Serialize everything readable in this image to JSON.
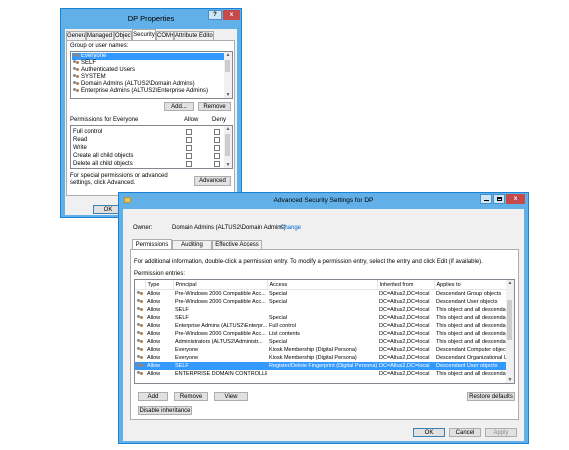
{
  "dp": {
    "title": "DP Properties",
    "help_btn": "?",
    "close_btn": "x",
    "tabs": [
      "General",
      "Managed By",
      "Object",
      "Security",
      "COM+",
      "Attribute Editor"
    ],
    "active_tab": "Security",
    "group_label": "Group or user names:",
    "users": [
      "Everyone",
      "SELF",
      "Authenticated Users",
      "SYSTEM",
      "Domain Admins (ALTUS2\\Domain Admins)",
      "Enterprise Admins (ALTUS2\\Enterprise Admins)"
    ],
    "add_btn": "Add...",
    "remove_btn": "Remove",
    "perm_label": "Permissions for Everyone",
    "allow": "Allow",
    "deny": "Deny",
    "permissions": [
      "Full control",
      "Read",
      "Write",
      "Create all child objects",
      "Delete all child objects"
    ],
    "special_text": "For special permissions or advanced settings, click Advanced.",
    "advanced_btn": "Advanced",
    "ok_btn": "OK"
  },
  "adv": {
    "title": "Advanced Security Settings for DP",
    "owner_label": "Owner:",
    "owner_value": "Domain Admins (ALTUS2\\Domain Admins)",
    "change_link": "Change",
    "tabs": [
      "Permissions",
      "Auditing",
      "Effective Access"
    ],
    "active_tab": "Permissions",
    "info_text": "For additional information, double-click a permission entry. To modify a permission entry, select the entry and click Edit (if available).",
    "entries_label": "Permission entries:",
    "columns": [
      "Type",
      "Principal",
      "Access",
      "Inherited from",
      "Applies to"
    ],
    "rows": [
      [
        "Allow",
        "Pre-Windows 2000 Compatible Acc...",
        "Special",
        "DC=Altus2,DC=local",
        "Descendant Group objects"
      ],
      [
        "Allow",
        "Pre-Windows 2000 Compatible Acc...",
        "Special",
        "DC=Altus2,DC=local",
        "Descendant User objects"
      ],
      [
        "Allow",
        "SELF",
        "",
        "DC=Altus2,DC=local",
        "This object and all descendant"
      ],
      [
        "Allow",
        "SELF",
        "Special",
        "DC=Altus2,DC=local",
        "This object and all descendant"
      ],
      [
        "Allow",
        "Enterprise Admins (ALTUS2\\Enterpr...",
        "Full control",
        "DC=Altus2,DC=local",
        "This object and all descendant"
      ],
      [
        "Allow",
        "Pre-Windows 2000 Compatible Acc...",
        "List contents",
        "DC=Altus2,DC=local",
        "This object and all descendant"
      ],
      [
        "Allow",
        "Administrators (ALTUS2\\Administr...",
        "Special",
        "DC=Altus2,DC=local",
        "This object and all descendant"
      ],
      [
        "Allow",
        "Everyone",
        "Kiosk Membership (Digital Persona)",
        "DC=Altus2,DC=local",
        "Descendant Computer objects"
      ],
      [
        "Allow",
        "Everyone",
        "Kiosk Membership (Digital Persona)",
        "DC=Altus2,DC=local",
        "Descendant Organizational Uni"
      ],
      [
        "Allow",
        "SELF",
        "Register/Delete Fingerprint (Digital Persona)",
        "DC=Altus2,DC=local",
        "Descendant User objects"
      ],
      [
        "Allow",
        "ENTERPRISE DOMAIN CONTROLLE...",
        "",
        "DC=Altus2,DC=local",
        "This object and all descendant"
      ]
    ],
    "selected_row": 9,
    "add_btn": "Add",
    "remove_btn": "Remove",
    "view_btn": "View",
    "restore_btn": "Restore defaults",
    "disable_btn": "Disable inheritance",
    "ok_btn": "OK",
    "cancel_btn": "Cancel",
    "apply_btn": "Apply"
  }
}
